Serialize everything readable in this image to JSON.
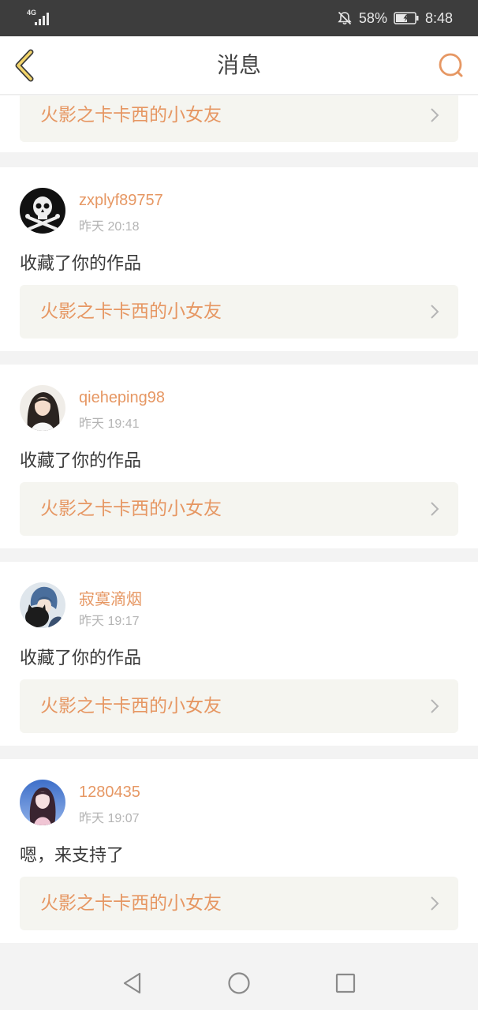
{
  "status_bar": {
    "network_type": "4G",
    "battery_percent": "58%",
    "time": "8:48",
    "icons": [
      "signal-icon",
      "mute-icon",
      "battery-charging-icon"
    ]
  },
  "nav": {
    "title": "消息",
    "back_icon": "chevron-left-icon",
    "search_icon": "search-icon"
  },
  "messages": [
    {
      "work_title": "火影之卡卡西的小女友"
    },
    {
      "username": "zxplyf89757",
      "time": "昨天 20:18",
      "comment": "收藏了你的作品",
      "work_title": "火影之卡卡西的小女友",
      "avatar": "skull-avatar"
    },
    {
      "username": "qieheping98",
      "time": "昨天 19:41",
      "comment": "收藏了你的作品",
      "work_title": "火影之卡卡西的小女友",
      "avatar": "girl-photo-avatar"
    },
    {
      "username": "寂寞滴烟",
      "time": "昨天 19:17",
      "comment": "收藏了你的作品",
      "work_title": "火影之卡卡西的小女友",
      "avatar": "anime-boy-cat-avatar"
    },
    {
      "username": "1280435",
      "time": "昨天 19:07",
      "comment": "嗯，来支持了",
      "work_title": "火影之卡卡西的小女友",
      "avatar": "anime-girl-avatar"
    }
  ],
  "colors": {
    "accent": "#e69763",
    "link_bg": "#f5f5f0",
    "status_bar_bg": "#3d3d3d",
    "timestamp": "#b4b4b4"
  },
  "system_nav": {
    "icons": [
      "back-triangle-icon",
      "home-circle-icon",
      "recents-square-icon"
    ]
  }
}
